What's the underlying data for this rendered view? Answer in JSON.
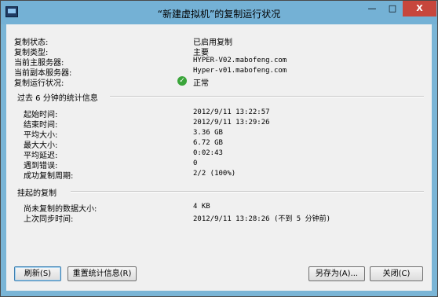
{
  "window": {
    "title": "“新建虚拟机”的复制运行状况",
    "min_label": "—",
    "max_label": "□",
    "close_label": "X"
  },
  "summary": [
    {
      "label": "复制状态:",
      "value": "已启用复制"
    },
    {
      "label": "复制类型:",
      "value": "主要"
    },
    {
      "label": "当前主服务器:",
      "value": "HYPER-V02.mabofeng.com"
    },
    {
      "label": "当前副本服务器:",
      "value": "Hyper-v01.mabofeng.com"
    },
    {
      "label": "复制运行状况:",
      "value": "正常",
      "icon": "check-icon"
    }
  ],
  "stats_group": {
    "title": "过去 6 分钟的统计信息",
    "rows": [
      {
        "label": "起始时间:",
        "value": "2012/9/11 13:22:57"
      },
      {
        "label": "结束时间:",
        "value": "2012/9/11 13:29:26"
      },
      {
        "label": "平均大小:",
        "value": "3.36 GB"
      },
      {
        "label": "最大大小:",
        "value": "6.72 GB"
      },
      {
        "label": "平均延迟:",
        "value": "0:02:43"
      },
      {
        "label": "遇到错误:",
        "value": "0"
      },
      {
        "label": "成功复制周期:",
        "value": "2/2 (100%)"
      }
    ]
  },
  "pending_group": {
    "title": "挂起的复制",
    "rows": [
      {
        "label": "尚未复制的数据大小:",
        "value": "4 KB"
      },
      {
        "label": "上次同步时间:",
        "value": "2012/9/11 13:28:26 (不到 5 分钟前)"
      }
    ]
  },
  "buttons": {
    "refresh": "刷新(S)",
    "reset_stats": "重置统计信息(R)",
    "save_as": "另存为(A)...",
    "close": "关闭(C)"
  },
  "colors": {
    "titlebar": "#74b1d5",
    "close_button": "#c7463c",
    "ok_icon": "#3aa53a"
  }
}
